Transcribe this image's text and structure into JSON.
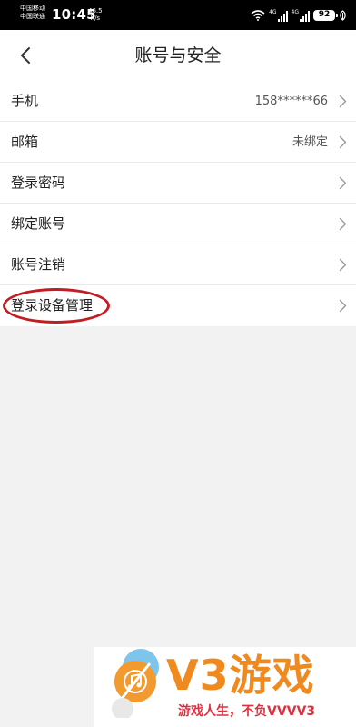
{
  "status_bar": {
    "carrier_1": "中国移动",
    "carrier_2": "中国联通",
    "time": "10:45",
    "speed_value": "46.5",
    "speed_unit": "K/s",
    "net_1": "4G",
    "net_2": "4G",
    "battery": "92"
  },
  "header": {
    "title": "账号与安全"
  },
  "settings": {
    "items": [
      {
        "label": "手机",
        "value": "158******66"
      },
      {
        "label": "邮箱",
        "value": "未绑定"
      },
      {
        "label": "登录密码"
      },
      {
        "label": "绑定账号"
      },
      {
        "label": "账号注销"
      },
      {
        "label": "登录设备管理",
        "highlighted": true
      }
    ]
  },
  "watermark": {
    "brand": "V3游戏",
    "slogan": "游戏人生，不负VVVV3"
  },
  "colors": {
    "annotation": "#c11d23",
    "brand_orange": "#f08a1f",
    "slogan_red": "#e0303f"
  }
}
